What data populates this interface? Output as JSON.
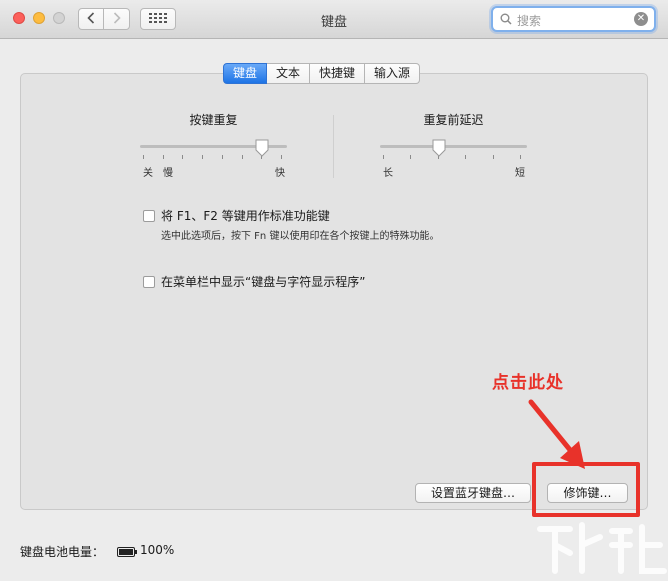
{
  "window": {
    "title": "键盘"
  },
  "search": {
    "placeholder": "搜索"
  },
  "tabs": [
    {
      "label": "键盘",
      "active": true
    },
    {
      "label": "文本",
      "active": false
    },
    {
      "label": "快捷键",
      "active": false
    },
    {
      "label": "输入源",
      "active": false
    }
  ],
  "key_repeat": {
    "label": "按键重复",
    "min_label": "关",
    "slow_label": "慢",
    "max_label": "快",
    "value_fraction": 0.83
  },
  "delay_until_repeat": {
    "label": "重复前延迟",
    "min_label": "长",
    "max_label": "短",
    "value_fraction": 0.4
  },
  "fn_keys": {
    "label": "将 F1、F2 等键用作标准功能键",
    "note": "选中此选项后，按下 Fn 键以使用印在各个按键上的特殊功能。",
    "checked": false
  },
  "show_viewer": {
    "label": "在菜单栏中显示“键盘与字符显示程序”",
    "checked": false
  },
  "buttons": {
    "bluetooth_label": "设置蓝牙键盘…",
    "modifier_label": "修饰键…"
  },
  "annotation": {
    "text": "点击此处",
    "color": "#e8322a"
  },
  "battery": {
    "label": "键盘电池电量：",
    "value": "100%"
  },
  "colors": {
    "accent": "#1e74e6",
    "annotation": "#e8322a"
  }
}
